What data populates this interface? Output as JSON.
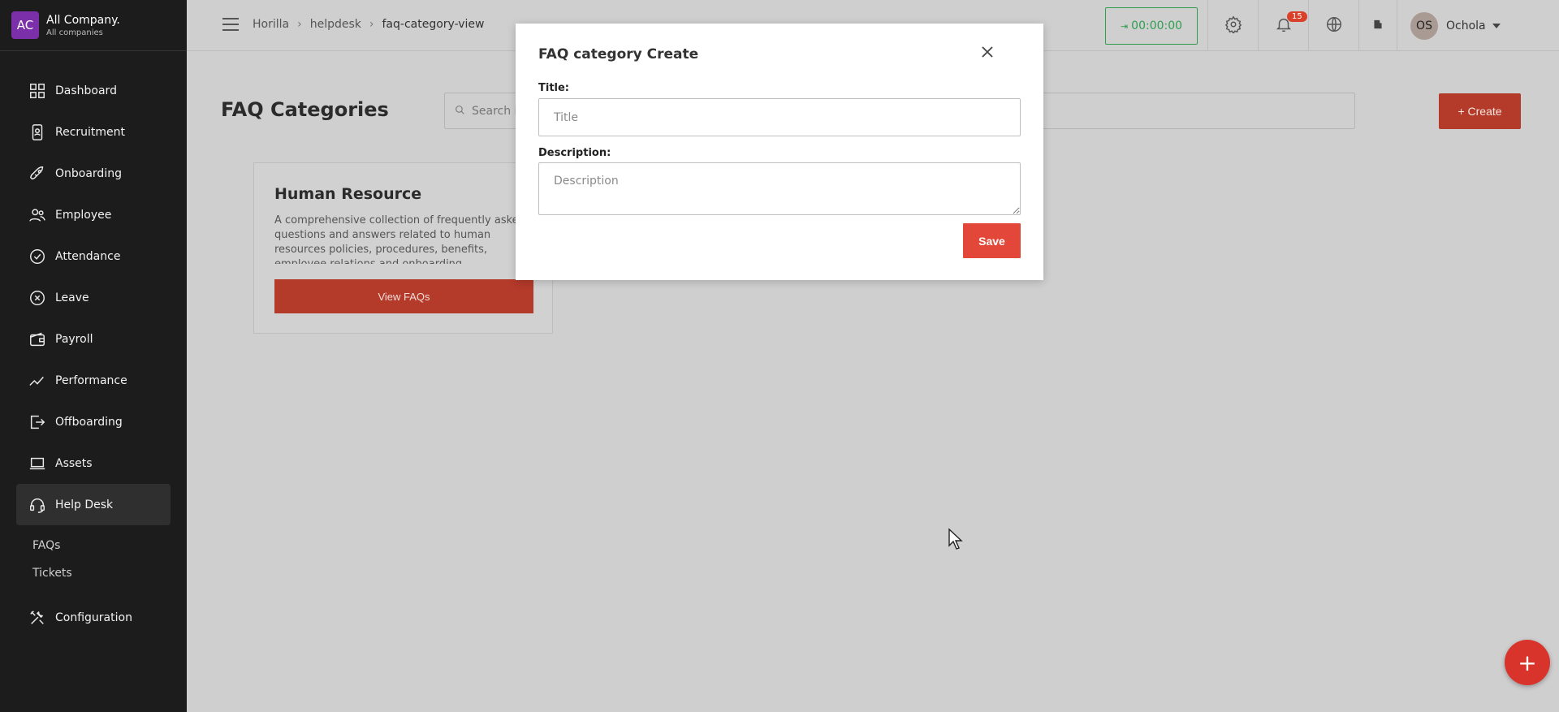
{
  "company": {
    "initials": "AC",
    "name": "All Company.",
    "sub": "All companies"
  },
  "sidebar": {
    "items": [
      {
        "label": "Dashboard",
        "icon": "dashboard-icon"
      },
      {
        "label": "Recruitment",
        "icon": "recruitment-icon"
      },
      {
        "label": "Onboarding",
        "icon": "rocket-icon"
      },
      {
        "label": "Employee",
        "icon": "people-icon"
      },
      {
        "label": "Attendance",
        "icon": "check-circle-icon"
      },
      {
        "label": "Leave",
        "icon": "x-circle-icon"
      },
      {
        "label": "Payroll",
        "icon": "wallet-icon"
      },
      {
        "label": "Performance",
        "icon": "trend-icon"
      },
      {
        "label": "Offboarding",
        "icon": "exit-icon"
      },
      {
        "label": "Assets",
        "icon": "laptop-icon"
      },
      {
        "label": "Help Desk",
        "icon": "headset-icon",
        "active": true
      }
    ],
    "subitems": [
      "FAQs",
      "Tickets"
    ],
    "config": {
      "label": "Configuration",
      "icon": "tools-icon"
    }
  },
  "topbar": {
    "breadcrumb": [
      "Horilla",
      "helpdesk",
      "faq-category-view"
    ],
    "timer": "00:00:00",
    "notification_count": "15",
    "user": {
      "initials": "OS",
      "name": "Ochola"
    }
  },
  "main": {
    "title": "FAQ Categories",
    "search_placeholder": "Search in",
    "create_label": "+ Create",
    "cards": [
      {
        "title": "Human Resource",
        "description": "A comprehensive collection of frequently asked questions and answers related to human resources policies, procedures, benefits, employee relations and onboarding.",
        "button": "View FAQs"
      }
    ]
  },
  "modal": {
    "title": "FAQ category Create",
    "title_label": "Title:",
    "title_placeholder": "Title",
    "description_label": "Description:",
    "description_placeholder": "Description",
    "save_label": "Save"
  },
  "colors": {
    "accent": "#e2473a",
    "sidebar": "#1c1c1c",
    "timer": "#2f9e4f"
  }
}
